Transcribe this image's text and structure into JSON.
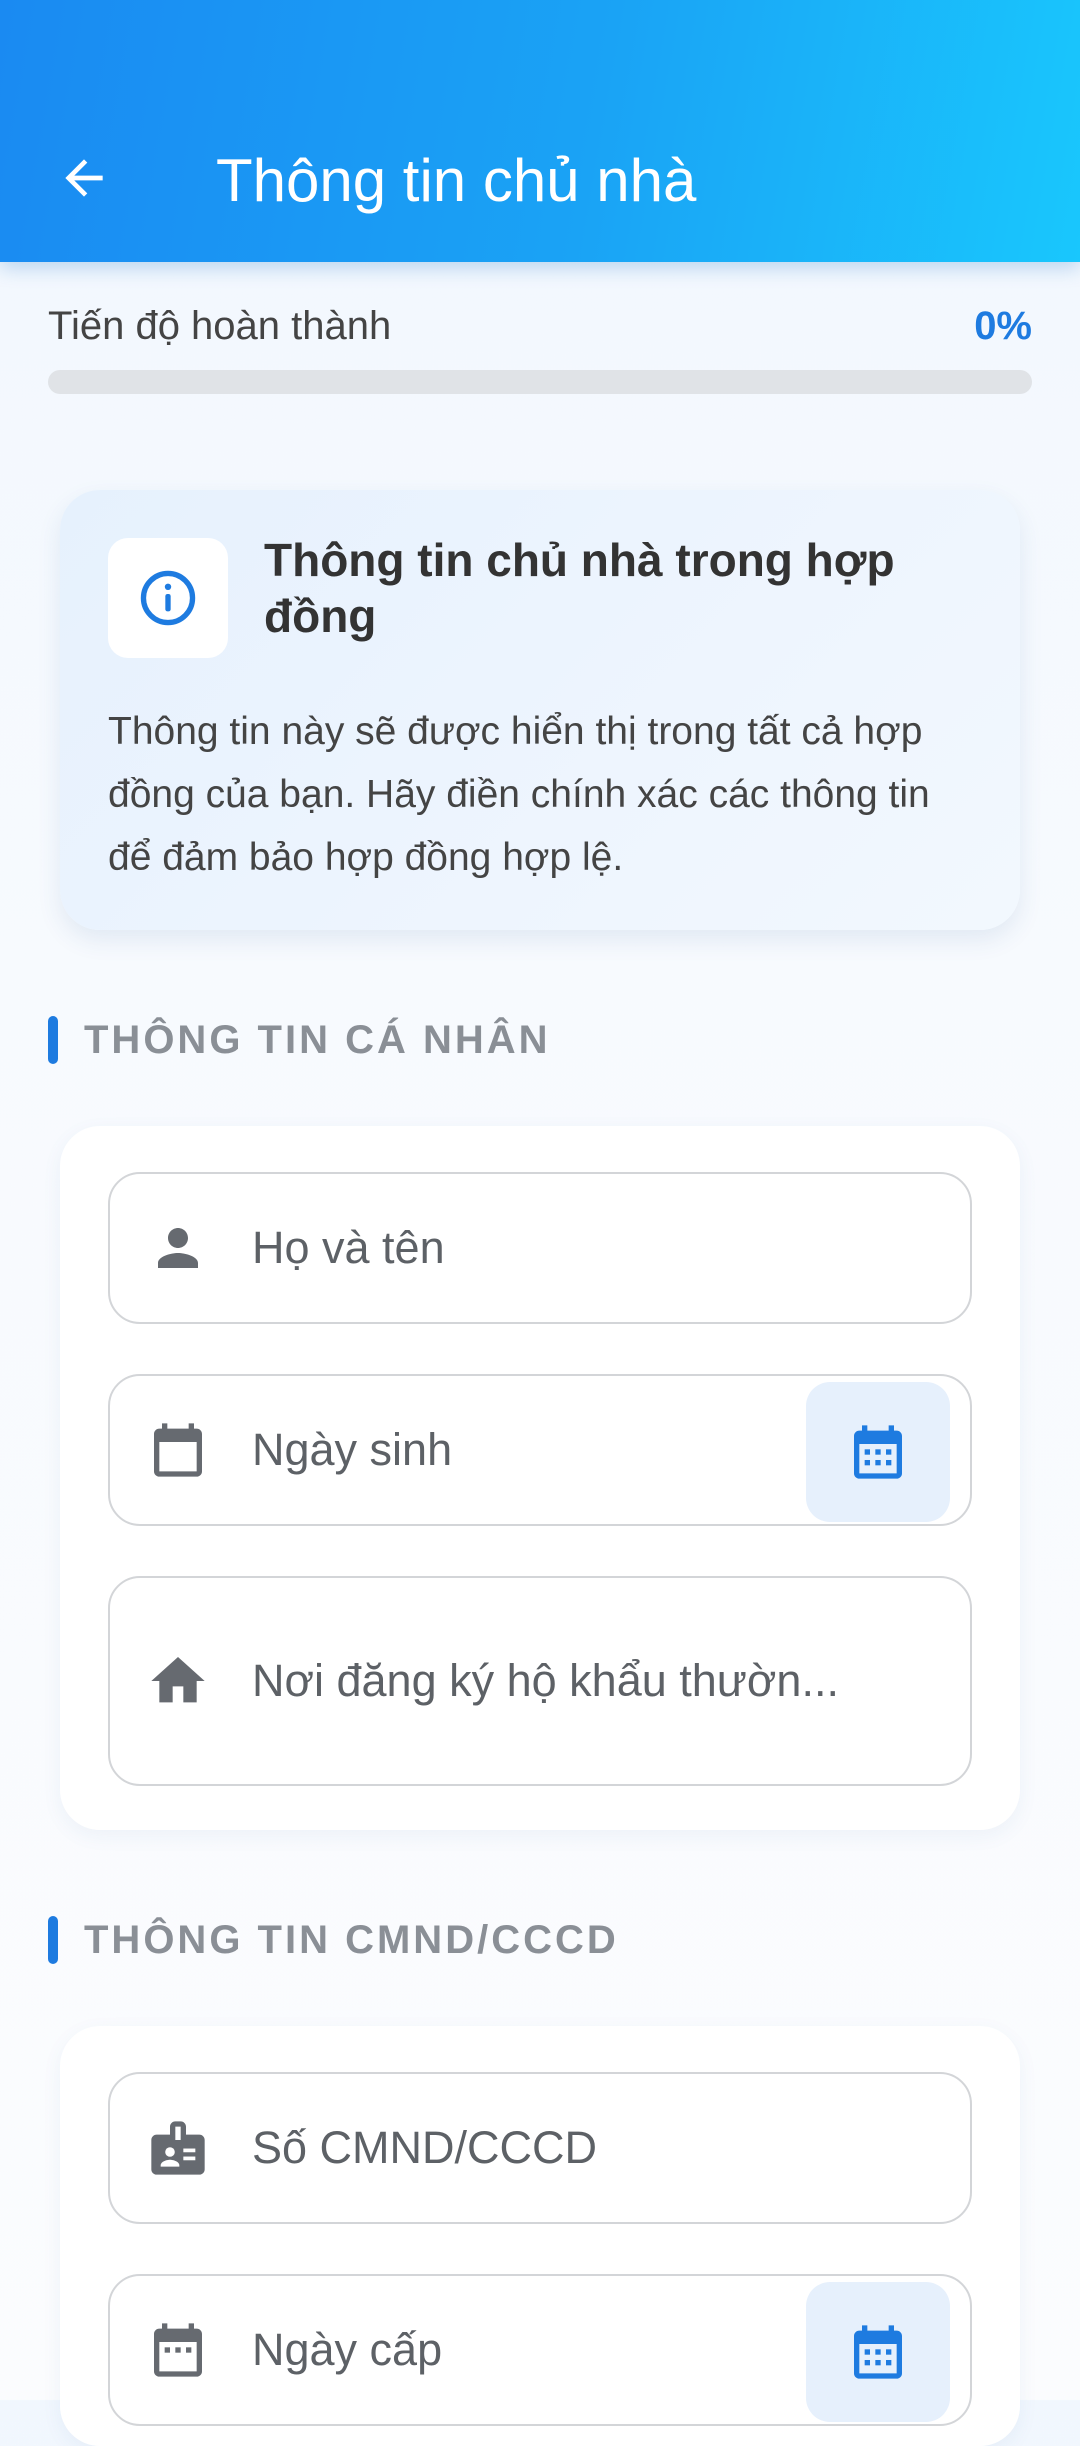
{
  "header": {
    "title": "Thông tin chủ nhà",
    "back_icon": "arrow-back-icon"
  },
  "progress": {
    "label": "Tiến độ hoàn thành",
    "value_text": "0%",
    "value": 0
  },
  "info_card": {
    "icon": "info-icon",
    "title": "Thông tin chủ nhà trong hợp đồng",
    "description": "Thông tin này sẽ được hiển thị trong tất cả hợp đồng của bạn. Hãy điền chính xác các thông tin để đảm bảo hợp đồng hợp lệ."
  },
  "sections": {
    "personal": {
      "title": "THÔNG TIN CÁ NHÂN",
      "fields": {
        "full_name": {
          "placeholder": "Họ và tên",
          "icon": "person-icon"
        },
        "birth_date": {
          "placeholder": "Ngày sinh",
          "icon": "calendar-icon",
          "action_icon": "calendar-picker-icon"
        },
        "residence": {
          "placeholder": "Nơi đăng ký hộ khẩu thườn...",
          "icon": "home-icon"
        }
      }
    },
    "id_card": {
      "title": "THÔNG TIN CMND/CCCD",
      "fields": {
        "id_number": {
          "placeholder": "Số CMND/CCCD",
          "icon": "id-badge-icon"
        },
        "issue_date": {
          "placeholder": "Ngày cấp",
          "icon": "calendar-icon",
          "action_icon": "calendar-picker-icon"
        }
      }
    }
  },
  "colors": {
    "primary": "#1e7be0",
    "appbar_start": "#1a8af2",
    "appbar_end": "#19c7fd",
    "section_label": "#8a8f96"
  }
}
